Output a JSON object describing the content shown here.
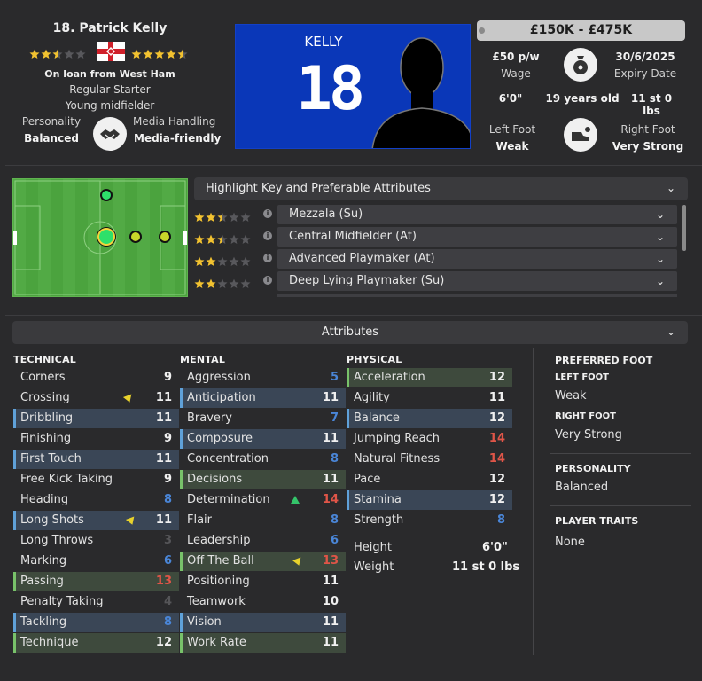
{
  "player": {
    "name": "18. Patrick Kelly",
    "current_ability_stars": 2.5,
    "potential_ability_stars": 4.5,
    "loan_text": "On loan from West Ham",
    "squad_status": "Regular Starter",
    "role_desc": "Young midfielder",
    "personality_label": "Personality",
    "personality_value": "Balanced",
    "media_label": "Media Handling",
    "media_value": "Media-friendly"
  },
  "kit": {
    "name": "KELLY",
    "number": "18",
    "color": "#0a37b8"
  },
  "value": {
    "range": "£150K - £475K",
    "wage": "£50 p/w",
    "wage_label": "Wage",
    "expiry": "30/6/2025",
    "expiry_label": "Expiry Date",
    "height": "6'0\"",
    "age": "19 years old",
    "weight": "11 st 0 lbs",
    "left_foot_label": "Left Foot",
    "left_foot": "Weak",
    "right_foot_label": "Right Foot",
    "right_foot": "Very Strong"
  },
  "roles": {
    "header": "Highlight Key and Preferable Attributes",
    "items": [
      {
        "name": "Mezzala (Su)",
        "stars": 2.5
      },
      {
        "name": "Central Midfielder (At)",
        "stars": 2.5
      },
      {
        "name": "Advanced Playmaker (At)",
        "stars": 2
      },
      {
        "name": "Deep Lying Playmaker (Su)",
        "stars": 2
      }
    ]
  },
  "attributes_header": "Attributes",
  "columns": {
    "technical": {
      "title": "TECHNICAL",
      "items": [
        {
          "name": "Corners",
          "value": "9",
          "hl": "",
          "color": "#f0f0f0"
        },
        {
          "name": "Crossing",
          "value": "11",
          "hl": "",
          "color": "#f0f0f0",
          "arrow": "down"
        },
        {
          "name": "Dribbling",
          "value": "11",
          "hl": "blue",
          "color": "#f0f0f0"
        },
        {
          "name": "Finishing",
          "value": "9",
          "hl": "",
          "color": "#f0f0f0"
        },
        {
          "name": "First Touch",
          "value": "11",
          "hl": "blue",
          "color": "#f0f0f0"
        },
        {
          "name": "Free Kick Taking",
          "value": "9",
          "hl": "",
          "color": "#f0f0f0"
        },
        {
          "name": "Heading",
          "value": "8",
          "hl": "",
          "color": "#4a86d8"
        },
        {
          "name": "Long Shots",
          "value": "11",
          "hl": "blue",
          "color": "#f0f0f0",
          "arrow": "down"
        },
        {
          "name": "Long Throws",
          "value": "3",
          "hl": "",
          "color": "#555558"
        },
        {
          "name": "Marking",
          "value": "6",
          "hl": "",
          "color": "#4a86d8"
        },
        {
          "name": "Passing",
          "value": "13",
          "hl": "green",
          "color": "#e05548"
        },
        {
          "name": "Penalty Taking",
          "value": "4",
          "hl": "",
          "color": "#555558"
        },
        {
          "name": "Tackling",
          "value": "8",
          "hl": "blue",
          "color": "#4a86d8"
        },
        {
          "name": "Technique",
          "value": "12",
          "hl": "green",
          "color": "#f0f0f0"
        }
      ]
    },
    "mental": {
      "title": "MENTAL",
      "items": [
        {
          "name": "Aggression",
          "value": "5",
          "hl": "",
          "color": "#4a86d8"
        },
        {
          "name": "Anticipation",
          "value": "11",
          "hl": "blue",
          "color": "#f0f0f0"
        },
        {
          "name": "Bravery",
          "value": "7",
          "hl": "",
          "color": "#4a86d8"
        },
        {
          "name": "Composure",
          "value": "11",
          "hl": "blue",
          "color": "#f0f0f0"
        },
        {
          "name": "Concentration",
          "value": "8",
          "hl": "",
          "color": "#4a86d8"
        },
        {
          "name": "Decisions",
          "value": "11",
          "hl": "green",
          "color": "#f0f0f0"
        },
        {
          "name": "Determination",
          "value": "14",
          "hl": "",
          "color": "#e05548",
          "arrow": "up"
        },
        {
          "name": "Flair",
          "value": "8",
          "hl": "",
          "color": "#4a86d8"
        },
        {
          "name": "Leadership",
          "value": "6",
          "hl": "",
          "color": "#4a86d8"
        },
        {
          "name": "Off The Ball",
          "value": "13",
          "hl": "green",
          "color": "#e05548",
          "arrow": "down"
        },
        {
          "name": "Positioning",
          "value": "11",
          "hl": "",
          "color": "#f0f0f0"
        },
        {
          "name": "Teamwork",
          "value": "10",
          "hl": "",
          "color": "#f0f0f0"
        },
        {
          "name": "Vision",
          "value": "11",
          "hl": "blue",
          "color": "#f0f0f0"
        },
        {
          "name": "Work Rate",
          "value": "11",
          "hl": "green",
          "color": "#f0f0f0"
        }
      ]
    },
    "physical": {
      "title": "PHYSICAL",
      "items": [
        {
          "name": "Acceleration",
          "value": "12",
          "hl": "green",
          "color": "#f0f0f0"
        },
        {
          "name": "Agility",
          "value": "11",
          "hl": "",
          "color": "#f0f0f0"
        },
        {
          "name": "Balance",
          "value": "12",
          "hl": "blue",
          "color": "#f0f0f0"
        },
        {
          "name": "Jumping Reach",
          "value": "14",
          "hl": "",
          "color": "#e05548"
        },
        {
          "name": "Natural Fitness",
          "value": "14",
          "hl": "",
          "color": "#e05548"
        },
        {
          "name": "Pace",
          "value": "12",
          "hl": "",
          "color": "#f0f0f0"
        },
        {
          "name": "Stamina",
          "value": "12",
          "hl": "blue",
          "color": "#f0f0f0"
        },
        {
          "name": "Strength",
          "value": "8",
          "hl": "",
          "color": "#4a86d8"
        }
      ],
      "height_label": "Height",
      "height": "6'0\"",
      "weight_label": "Weight",
      "weight": "11 st 0 lbs"
    }
  },
  "side": {
    "preferred_foot_title": "PREFERRED FOOT",
    "left_foot_title": "LEFT FOOT",
    "left_foot": "Weak",
    "right_foot_title": "RIGHT FOOT",
    "right_foot": "Very Strong",
    "personality_title": "PERSONALITY",
    "personality": "Balanced",
    "traits_title": "PLAYER TRAITS",
    "traits": "None"
  }
}
